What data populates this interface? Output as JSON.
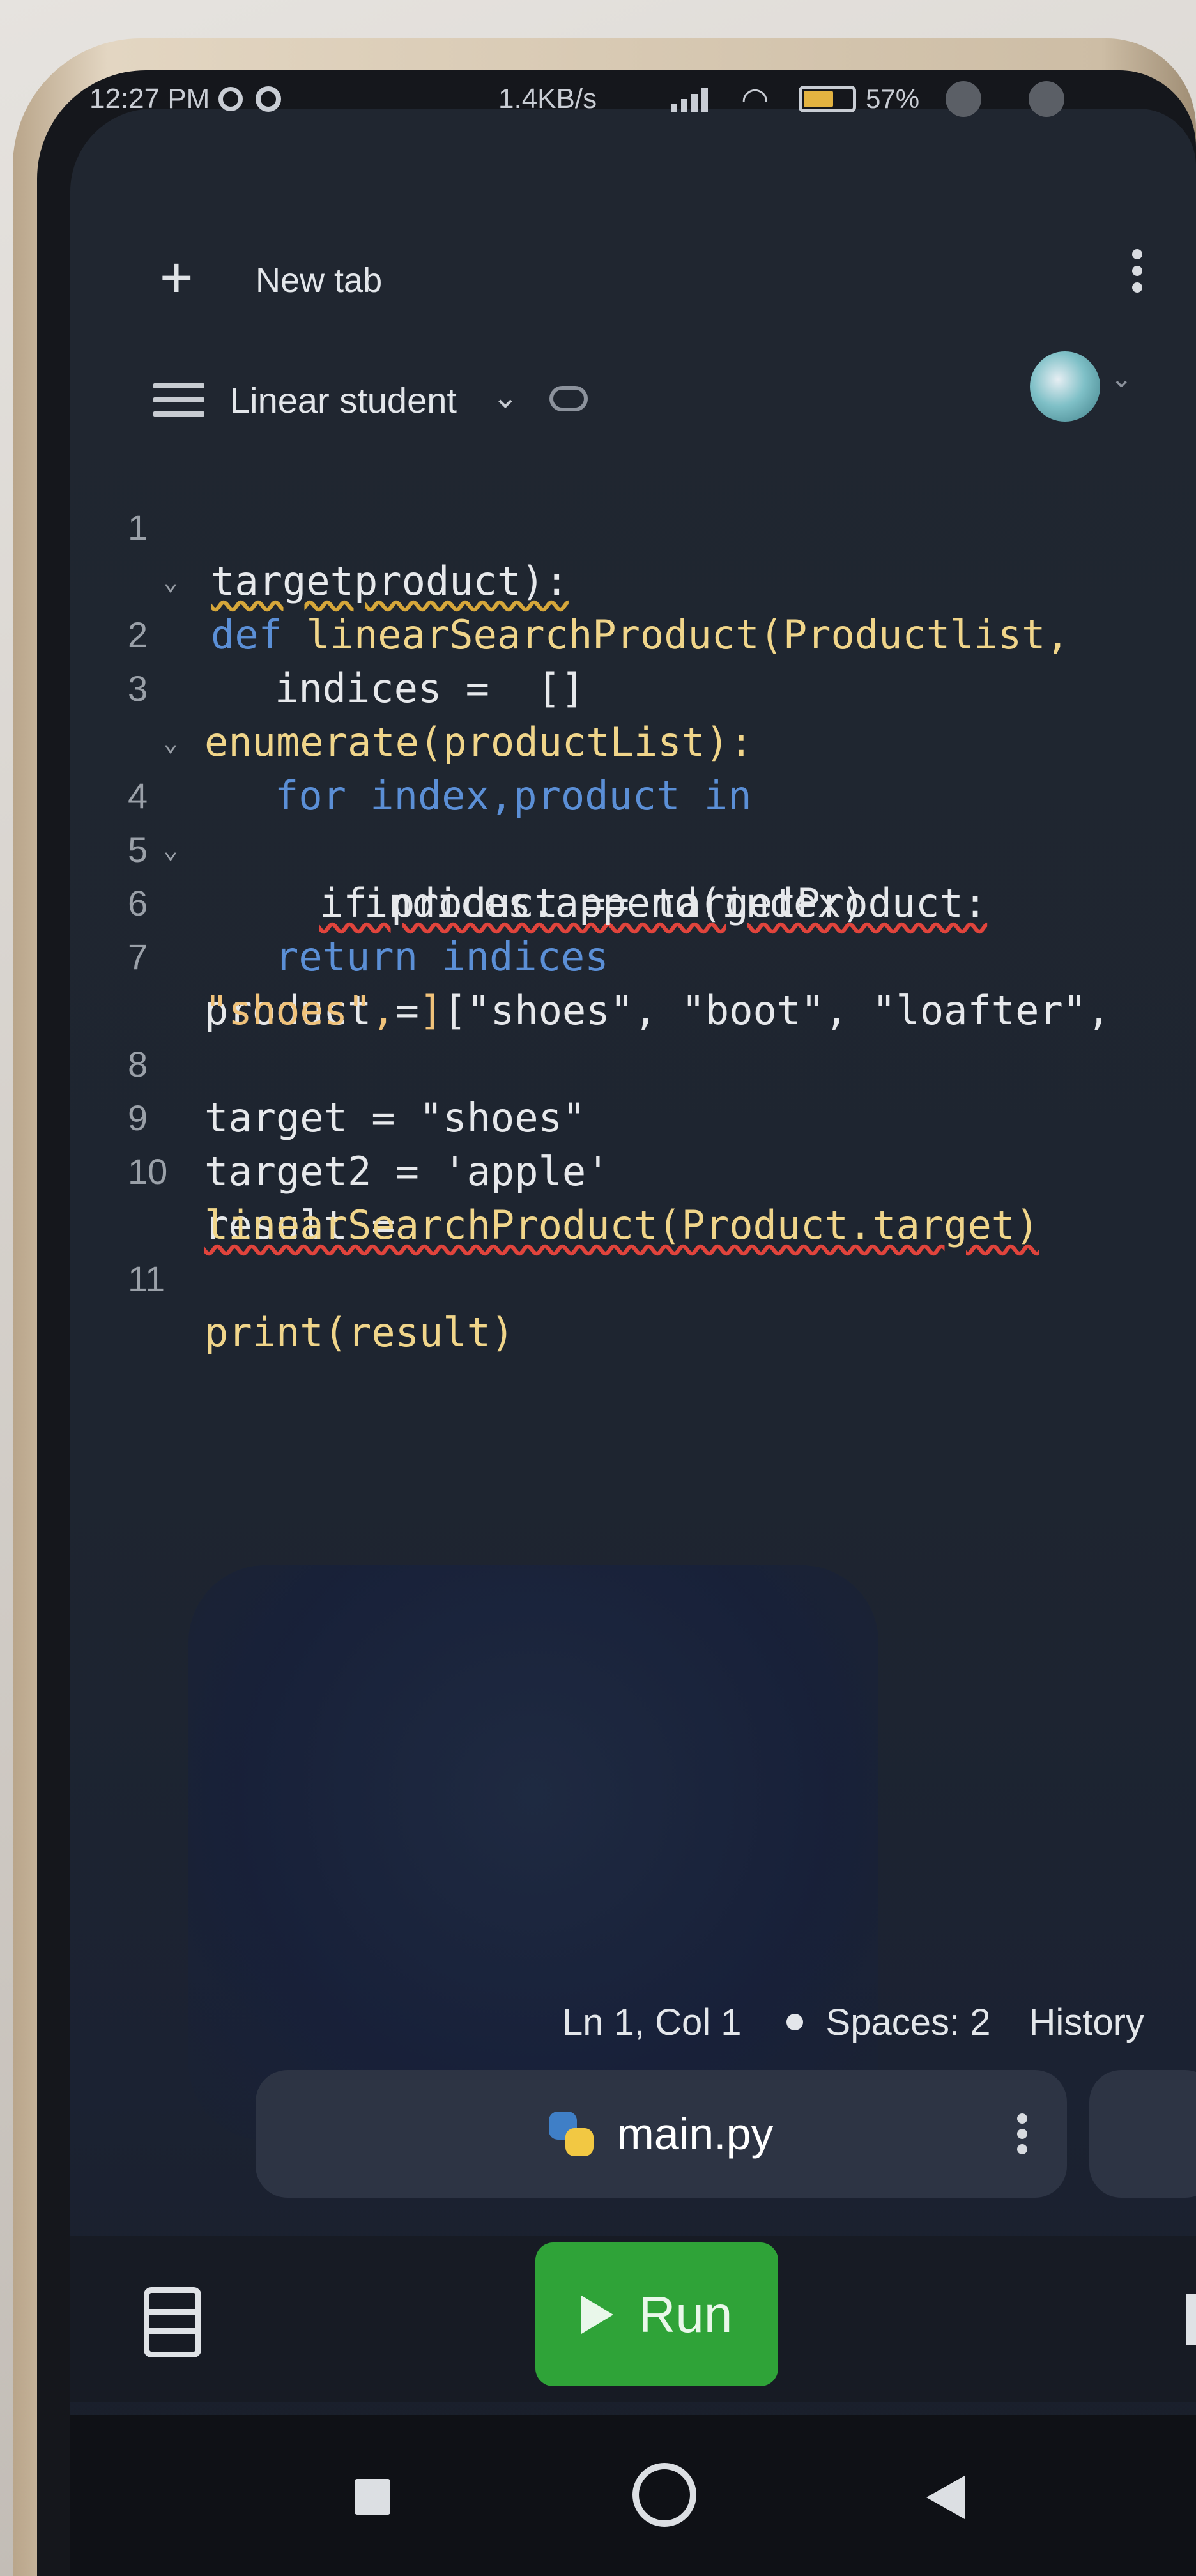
{
  "status_bar": {
    "time": "12:27 PM",
    "net_speed": "1.4KB/s",
    "battery": "57%"
  },
  "tab_bar": {
    "new_tab_label": "New tab"
  },
  "project": {
    "name": "Linear student"
  },
  "editor": {
    "line_numbers": [
      "1",
      "2",
      "3",
      "4",
      "5",
      "6",
      "7",
      "8",
      "9",
      "10",
      "11"
    ],
    "lines": [
      "def linearSearchProduct(Productlist,",
      "targetproduct):",
      "indices =  []",
      "for index,product in",
      "enumerate(productList):",
      "if product == targetProduct:",
      "indices.append(index)",
      "return indices",
      "product = [\"shoes\", \"boot\", \"loafter\",",
      "\"shoes\", ]",
      "target = \"shoes\"",
      "target2 = 'apple'",
      "result =",
      "linearSearchProduct(Product.target)",
      "print(result)"
    ]
  },
  "status_row": {
    "position": "Ln 1, Col 1",
    "spaces": "Spaces: 2",
    "history": "History"
  },
  "file_tab": {
    "filename": "main.py"
  },
  "run_button": {
    "label": "Run"
  },
  "colors": {
    "keyword": "#5b8fd6",
    "function": "#f0d58a",
    "string": "#f0c27a",
    "run_green": "#2fa338",
    "editor_bg": "#1e2530"
  }
}
